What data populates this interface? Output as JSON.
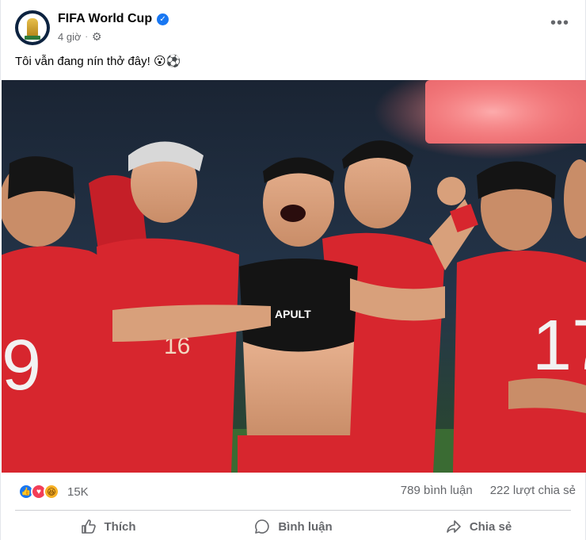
{
  "post": {
    "author": "FIFA World Cup",
    "time": "4 giờ",
    "caption": "Tôi vẫn đang nín thở đây! 😮⚽",
    "verified_icon": "verified-badge-icon",
    "privacy_icon": "gear-icon",
    "more_icon": "more-options-icon"
  },
  "photo": {
    "shirt_text": "APULT",
    "jersey_numbers": [
      "9",
      "16",
      "17"
    ]
  },
  "engagement": {
    "reaction_icons": [
      "like-icon",
      "love-icon",
      "haha-icon"
    ],
    "reaction_count": "15K",
    "comments": "789 bình luận",
    "shares": "222 lượt chia sẻ"
  },
  "actions": {
    "like_label": "Thích",
    "comment_label": "Bình luận",
    "share_label": "Chia sẻ"
  },
  "colors": {
    "accent": "#1877f2",
    "jersey_red": "#d7262e",
    "secondary_text": "#65676b"
  }
}
